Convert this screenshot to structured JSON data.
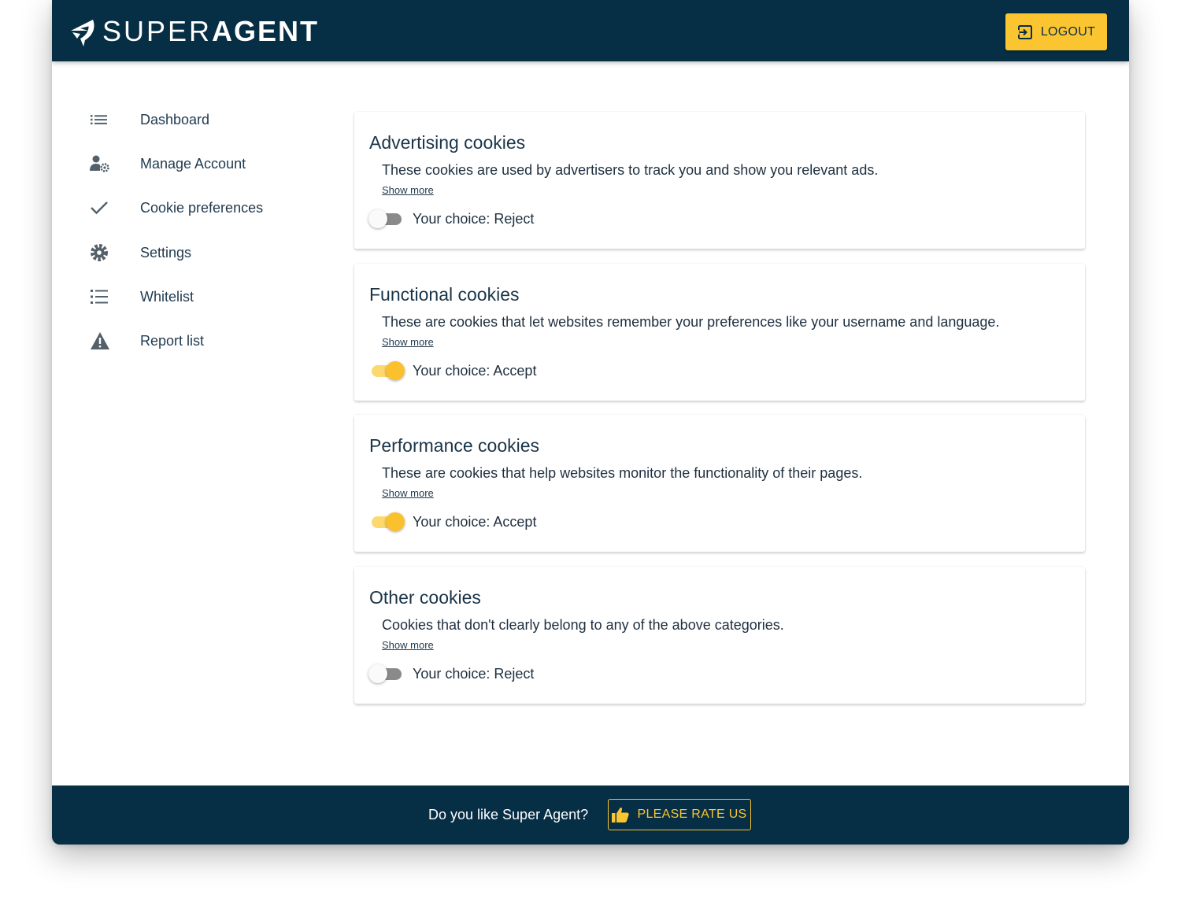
{
  "header": {
    "logo_light": "SUPER",
    "logo_bold": "AGENT",
    "logout_label": "LOGOUT"
  },
  "sidebar": {
    "items": [
      {
        "label": "Dashboard",
        "icon": "list-icon"
      },
      {
        "label": "Manage Account",
        "icon": "user-gear-icon"
      },
      {
        "label": "Cookie preferences",
        "icon": "check-icon"
      },
      {
        "label": "Settings",
        "icon": "gear-icon"
      },
      {
        "label": "Whitelist",
        "icon": "numbered-list-icon"
      },
      {
        "label": "Report list",
        "icon": "warning-icon"
      }
    ]
  },
  "cards": [
    {
      "title": "Advertising cookies",
      "description": "These cookies are used by advertisers to track you and show you relevant ads.",
      "show_more": "Show more",
      "choice": "Your choice: Reject",
      "enabled": false
    },
    {
      "title": "Functional cookies",
      "description": "These are cookies that let websites remember your preferences like your username and language.",
      "show_more": "Show more",
      "choice": "Your choice: Accept",
      "enabled": true
    },
    {
      "title": "Performance cookies",
      "description": "These are cookies that help websites monitor the functionality of their pages.",
      "show_more": "Show more",
      "choice": "Your choice: Accept",
      "enabled": true
    },
    {
      "title": "Other cookies",
      "description": "Cookies that don't clearly belong to any of the above categories.",
      "show_more": "Show more",
      "choice": "Your choice: Reject",
      "enabled": false
    }
  ],
  "footer": {
    "question": "Do you like Super Agent?",
    "rate_label": "PLEASE RATE US"
  },
  "colors": {
    "primary": "#062e44",
    "accent": "#fbc531"
  }
}
